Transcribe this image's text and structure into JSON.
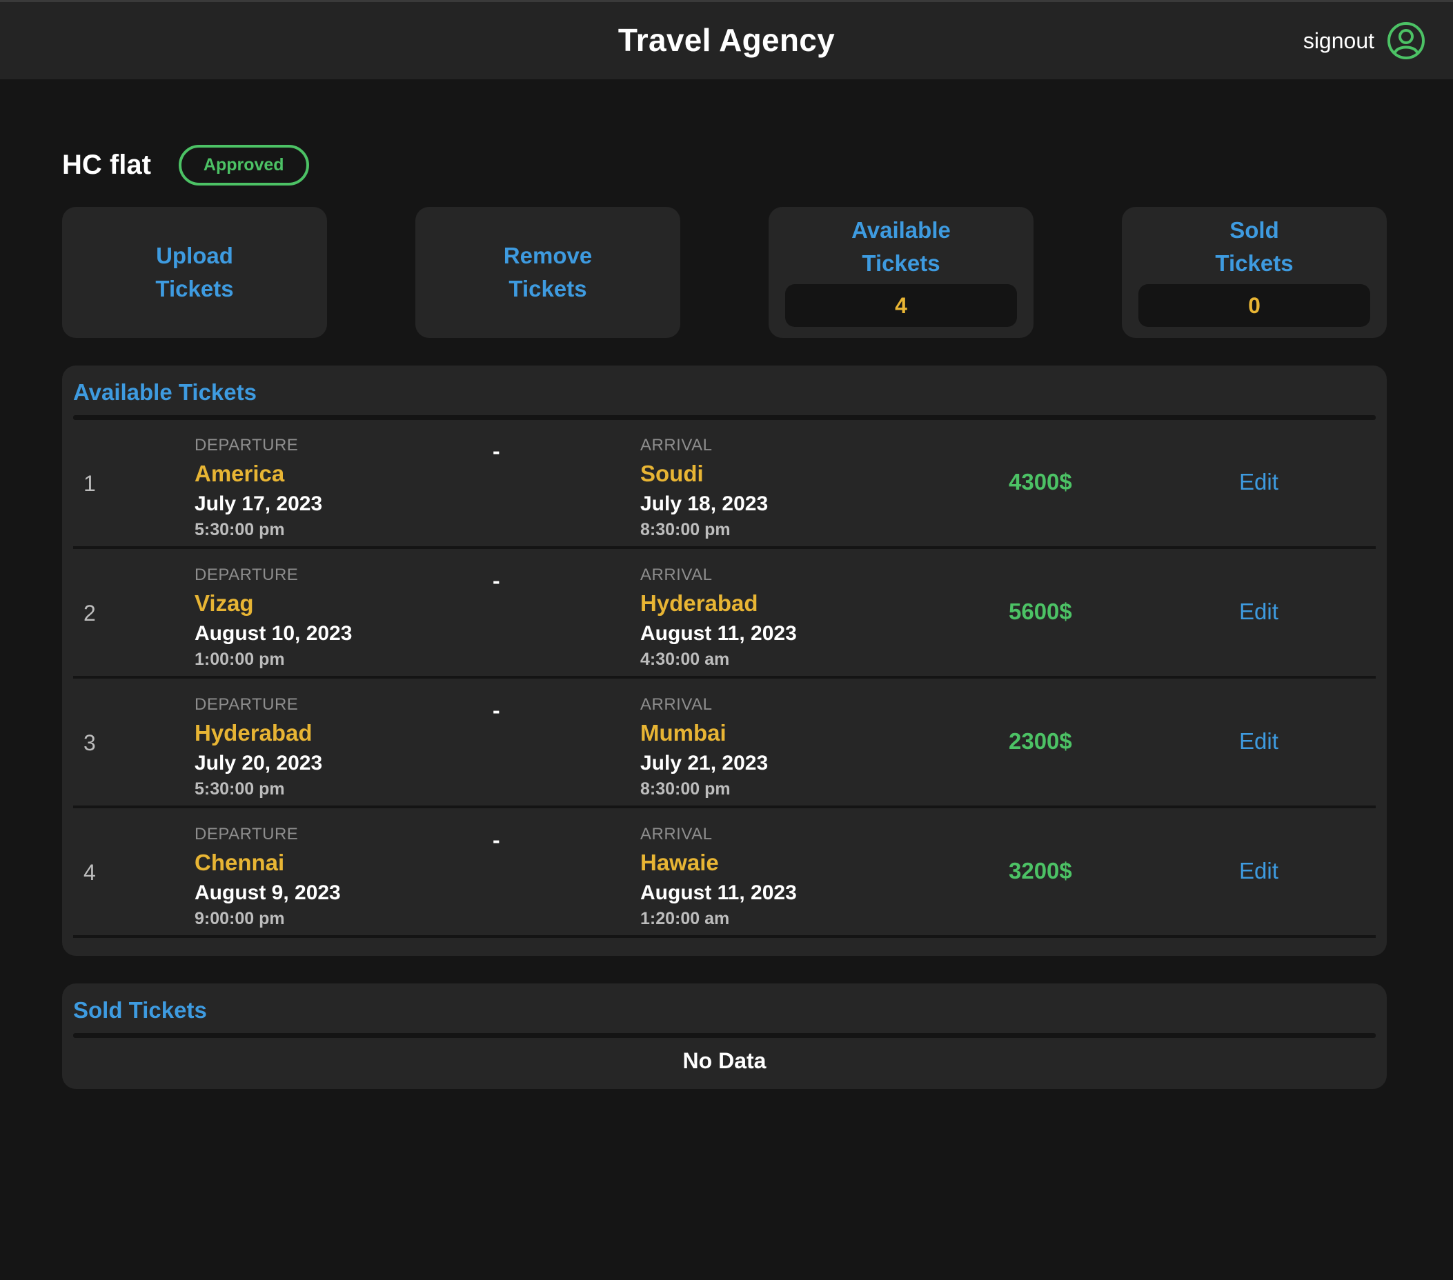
{
  "header": {
    "title": "Travel Agency",
    "signout_label": "signout",
    "user_icon": "user-circle-icon",
    "icon_color": "#4cc265"
  },
  "agency": {
    "name": "HC flat",
    "status": "Approved"
  },
  "cards": {
    "upload": "Upload Tickets",
    "remove": "Remove Tickets",
    "available": {
      "label": "Available Tickets",
      "value": "4"
    },
    "sold": {
      "label": "Sold Tickets",
      "value": "0"
    }
  },
  "available_section": {
    "title": "Available Tickets",
    "departure_caption": "DEPARTURE",
    "arrival_caption": "ARRIVAL",
    "separator": "-",
    "edit_label": "Edit",
    "tickets": [
      {
        "index": "1",
        "departure": {
          "city": "America",
          "date": "July 17, 2023",
          "time": "5:30:00 pm"
        },
        "arrival": {
          "city": "Soudi",
          "date": "July 18, 2023",
          "time": "8:30:00 pm"
        },
        "price": "4300$"
      },
      {
        "index": "2",
        "departure": {
          "city": "Vizag",
          "date": "August 10, 2023",
          "time": "1:00:00 pm"
        },
        "arrival": {
          "city": "Hyderabad",
          "date": "August 11, 2023",
          "time": "4:30:00 am"
        },
        "price": "5600$"
      },
      {
        "index": "3",
        "departure": {
          "city": "Hyderabad",
          "date": "July 20, 2023",
          "time": "5:30:00 pm"
        },
        "arrival": {
          "city": "Mumbai",
          "date": "July 21, 2023",
          "time": "8:30:00 pm"
        },
        "price": "2300$"
      },
      {
        "index": "4",
        "departure": {
          "city": "Chennai",
          "date": "August 9, 2023",
          "time": "9:00:00 pm"
        },
        "arrival": {
          "city": "Hawaie",
          "date": "August 11, 2023",
          "time": "1:20:00 am"
        },
        "price": "3200$"
      }
    ]
  },
  "sold_section": {
    "title": "Sold Tickets",
    "empty_text": "No Data"
  },
  "colors": {
    "background": "#151515",
    "surface": "#262626",
    "accent_blue": "#3e9be0",
    "accent_yellow": "#e8b534",
    "accent_green": "#4cc265"
  }
}
